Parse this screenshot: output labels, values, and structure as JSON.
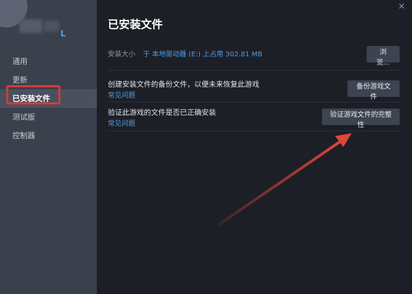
{
  "sidebar": {
    "game_suffix": "L",
    "items": [
      {
        "label": "通用"
      },
      {
        "label": "更新"
      },
      {
        "label": "已安装文件"
      },
      {
        "label": "测试版"
      },
      {
        "label": "控制器"
      }
    ],
    "active_index": 2
  },
  "main": {
    "title": "已安装文件",
    "close_icon": "×",
    "install_size_label": "安装大小",
    "install_size_value": "于 本地驱动器 (E:) 上占用 302.81 MB",
    "browse_button": "浏览...",
    "backup_text": "创建安装文件的备份文件，以便未来恢复此游戏",
    "backup_link": "常见问题",
    "backup_button": "备份游戏文件",
    "verify_text": "验证此游戏的文件是否已正确安装",
    "verify_link": "常见问题",
    "verify_button": "验证游戏文件的完整性"
  },
  "colors": {
    "accent_blue": "#4d9fe6",
    "highlight_red": "#d13c3c",
    "arrow_red": "#e0463a"
  }
}
